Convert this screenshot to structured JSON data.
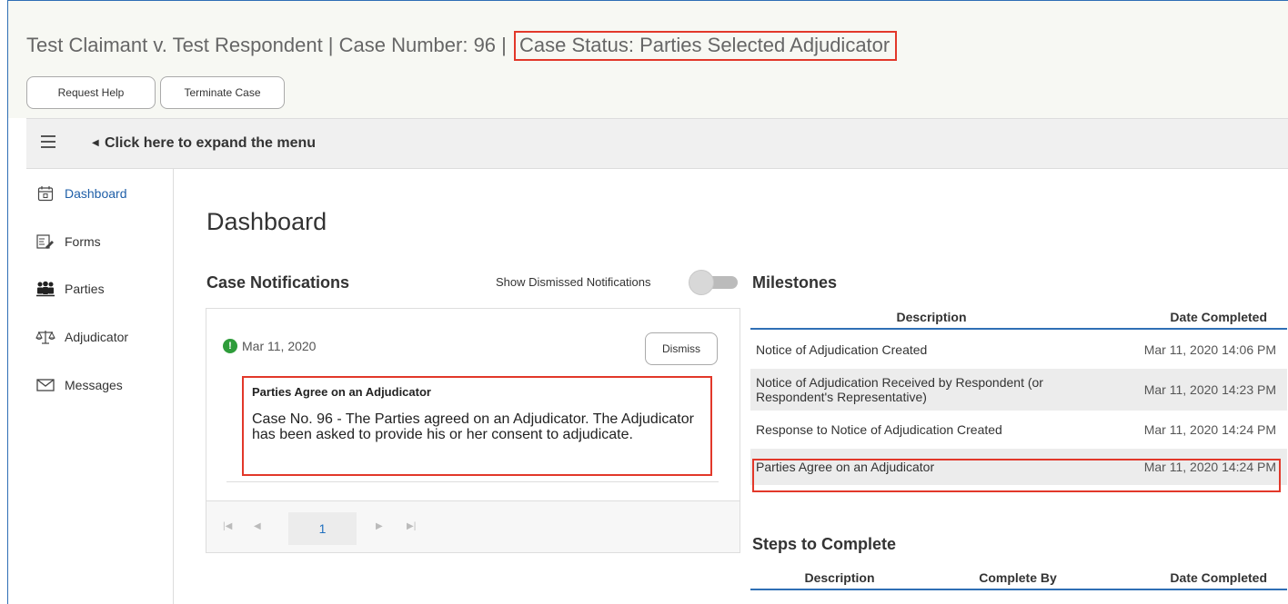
{
  "header": {
    "case_title": "Test Claimant v. Test Respondent | Case Number: 96 |",
    "case_status": "Case Status:   Parties Selected Adjudicator",
    "buttons": {
      "request_help": "Request Help",
      "terminate_case": "Terminate Case"
    }
  },
  "menu": {
    "expand_label": "Click here to expand the menu"
  },
  "sidebar": {
    "items": [
      {
        "label": "Dashboard",
        "icon": "calendar-icon",
        "active": true
      },
      {
        "label": "Forms",
        "icon": "forms-icon",
        "active": false
      },
      {
        "label": "Parties",
        "icon": "people-icon",
        "active": false
      },
      {
        "label": "Adjudicator",
        "icon": "scales-icon",
        "active": false
      },
      {
        "label": "Messages",
        "icon": "envelope-icon",
        "active": false
      }
    ]
  },
  "main": {
    "title": "Dashboard"
  },
  "notifications": {
    "title": "Case Notifications",
    "show_dismissed_label": "Show Dismissed Notifications",
    "show_dismissed_on": false,
    "items": [
      {
        "date": "Mar 11, 2020",
        "dismiss_label": "Dismiss",
        "heading": "Parties Agree on an Adjudicator",
        "body": "Case No. 96 - The Parties agreed on an Adjudicator. The Adjudicator has been asked to  provide his or her consent to adjudicate."
      }
    ],
    "pager": {
      "current_page": "1"
    }
  },
  "milestones": {
    "title": "Milestones",
    "columns": [
      "Description",
      "Date Completed"
    ],
    "rows": [
      {
        "description": "Notice of Adjudication Created",
        "date": "Mar 11, 2020 14:06 PM"
      },
      {
        "description": "Notice of Adjudication Received by Respondent (or Respondent's Representative)",
        "date": "Mar 11, 2020 14:23 PM"
      },
      {
        "description": "Response to Notice of Adjudication Created",
        "date": "Mar 11, 2020 14:24 PM"
      },
      {
        "description": "Parties Agree on an Adjudicator",
        "date": "Mar 11, 2020 14:24 PM"
      }
    ]
  },
  "steps": {
    "title": "Steps to Complete",
    "columns": [
      "Description",
      "Complete By",
      "Date Completed"
    ]
  },
  "colors": {
    "accent_blue": "#2f6fb5",
    "highlight_red": "#e2382a",
    "alert_green": "#2e9c3a",
    "link_blue": "#1f5fa8"
  }
}
